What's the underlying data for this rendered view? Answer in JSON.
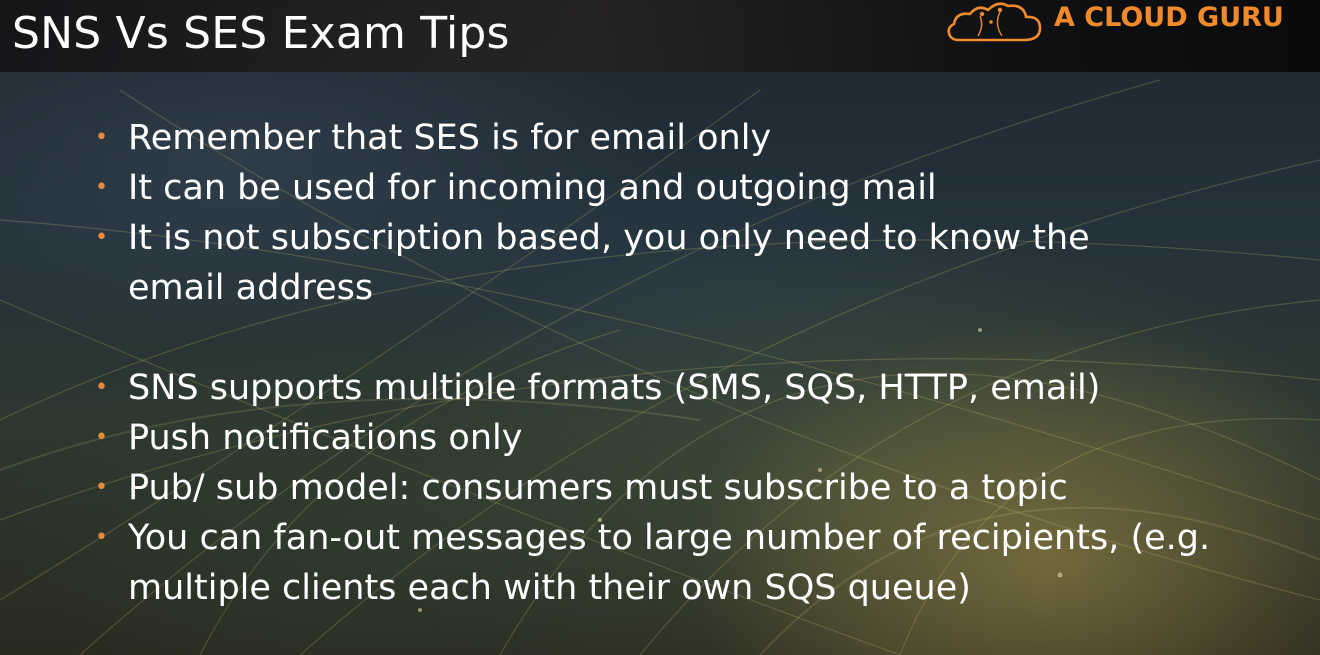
{
  "slide": {
    "title": "SNS Vs SES Exam Tips",
    "brand": {
      "name": "A CLOUD GURU",
      "icon": "cloud-icon",
      "color": "#f08a2a"
    },
    "bullet_color": "#ea8a3a",
    "ses_tips": [
      "Remember that SES is for email only",
      "It can be used for incoming and outgoing mail",
      "It is not subscription based, you only need to know the email address"
    ],
    "sns_tips": [
      "SNS supports multiple formats (SMS, SQS, HTTP, email)",
      "Push notifications only",
      "Pub/ sub model: consumers must subscribe to a topic",
      "You can fan-out messages to large number of recipients, (e.g. multiple clients each with their own SQS queue)"
    ]
  }
}
